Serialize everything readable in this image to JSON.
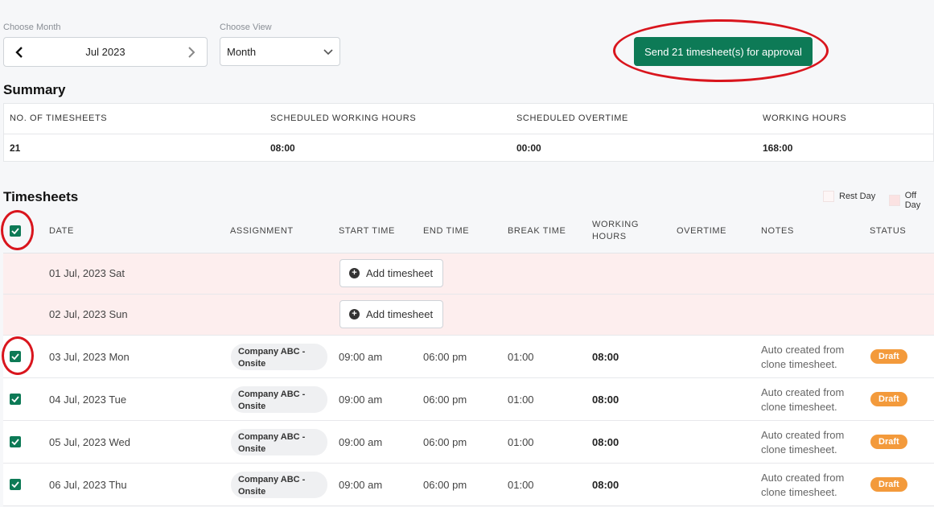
{
  "controls": {
    "month_label": "Choose Month",
    "month_value": "Jul 2023",
    "view_label": "Choose View",
    "view_value": "Month",
    "send_button": "Send 21 timesheet(s) for approval"
  },
  "summary": {
    "title": "Summary",
    "headers": [
      "NO. OF TIMESHEETS",
      "SCHEDULED WORKING HOURS",
      "SCHEDULED OVERTIME",
      "WORKING HOURS"
    ],
    "values": [
      "21",
      "08:00",
      "00:00",
      "168:00"
    ]
  },
  "timesheets": {
    "title": "Timesheets",
    "legend": {
      "rest_day": "Rest Day",
      "off_day": "Off Day"
    },
    "columns": {
      "date": "DATE",
      "assignment": "ASSIGNMENT",
      "start": "START TIME",
      "end": "END TIME",
      "break": "BREAK TIME",
      "working_1": "WORKING",
      "working_2": "HOURS",
      "overtime": "OVERTIME",
      "notes": "NOTES",
      "status": "STATUS"
    },
    "off_rows": [
      {
        "date": "01 Jul, 2023 Sat",
        "action": "Add timesheet"
      },
      {
        "date": "02 Jul, 2023 Sun",
        "action": "Add timesheet"
      }
    ],
    "rows": [
      {
        "date": "03 Jul, 2023 Mon",
        "assign_1": "Company ABC -",
        "assign_2": "Onsite",
        "start": "09:00 am",
        "end": "06:00 pm",
        "break": "01:00",
        "hours": "08:00",
        "notes_1": "Auto created from",
        "notes_2": "clone timesheet.",
        "status": "Draft"
      },
      {
        "date": "04 Jul, 2023 Tue",
        "assign_1": "Company ABC -",
        "assign_2": "Onsite",
        "start": "09:00 am",
        "end": "06:00 pm",
        "break": "01:00",
        "hours": "08:00",
        "notes_1": "Auto created from",
        "notes_2": "clone timesheet.",
        "status": "Draft"
      },
      {
        "date": "05 Jul, 2023 Wed",
        "assign_1": "Company ABC -",
        "assign_2": "Onsite",
        "start": "09:00 am",
        "end": "06:00 pm",
        "break": "01:00",
        "hours": "08:00",
        "notes_1": "Auto created from",
        "notes_2": "clone timesheet.",
        "status": "Draft"
      },
      {
        "date": "06 Jul, 2023 Thu",
        "assign_1": "Company ABC -",
        "assign_2": "Onsite",
        "start": "09:00 am",
        "end": "06:00 pm",
        "break": "01:00",
        "hours": "08:00",
        "notes_1": "Auto created from",
        "notes_2": "clone timesheet.",
        "status": "Draft"
      }
    ]
  },
  "colors": {
    "accent": "#0d7a56",
    "annotation": "#d9151d",
    "off_day_row": "#fdeeee",
    "draft_badge": "#f39a3b"
  },
  "icons": [
    "chevron-left-icon",
    "chevron-right-icon",
    "chevron-down-icon",
    "plus-circle-icon",
    "checkbox-checked-icon"
  ]
}
